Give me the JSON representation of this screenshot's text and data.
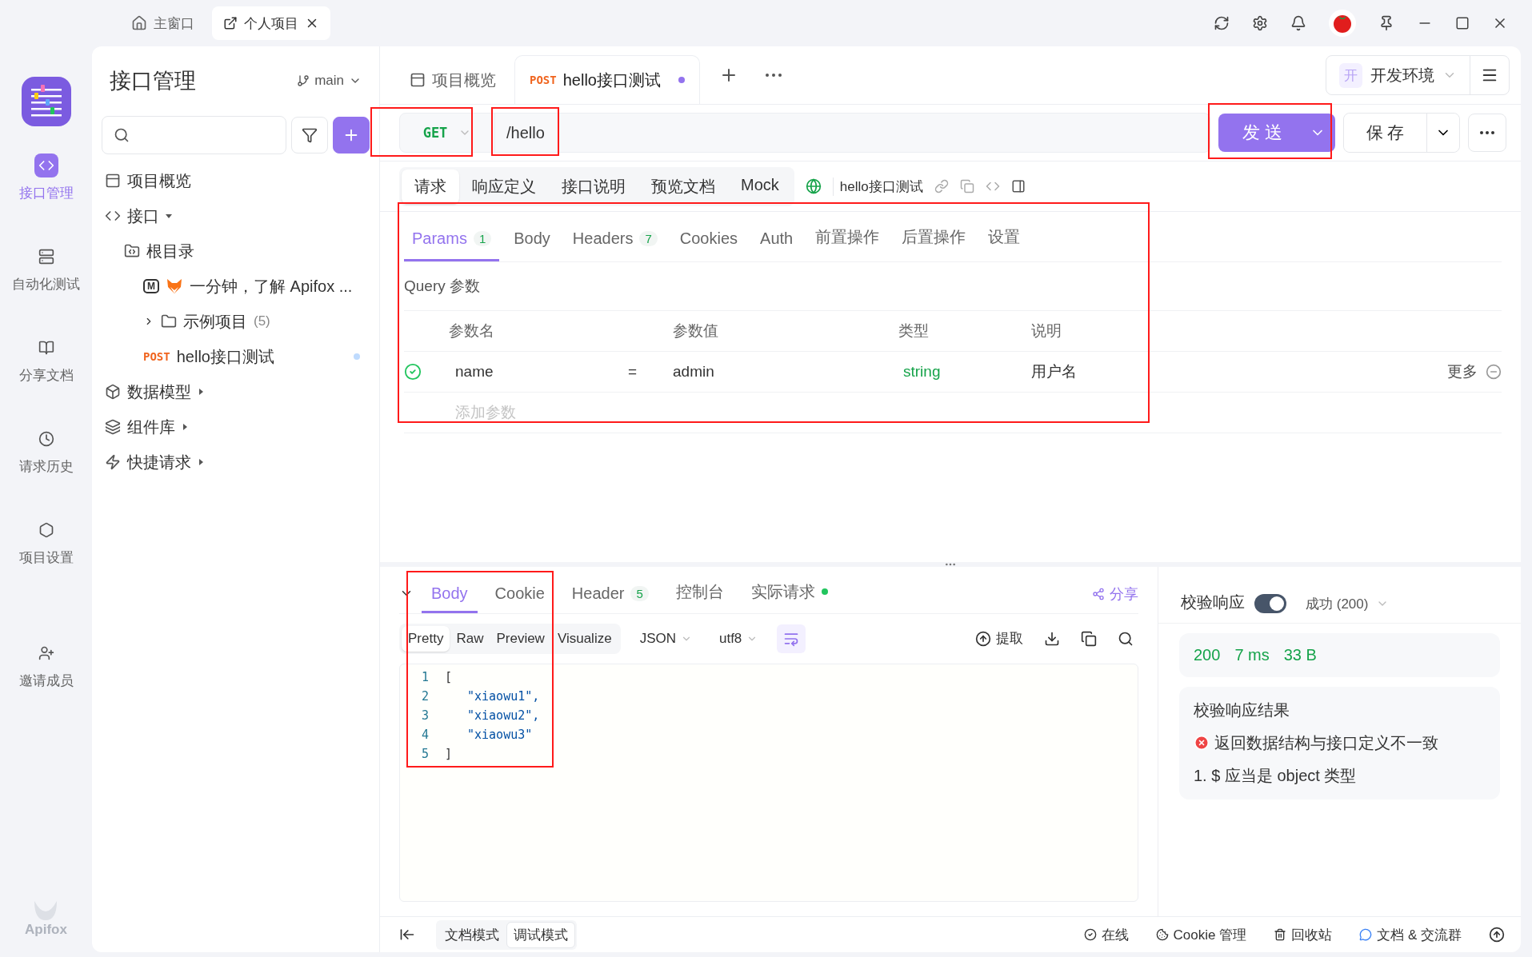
{
  "window_tabs": [
    {
      "label": "主窗口",
      "kind": "home",
      "selected": false
    },
    {
      "label": "个人项目",
      "kind": "project",
      "selected": true
    }
  ],
  "nav_rail": {
    "items": [
      {
        "label": "接口管理",
        "kind": "api",
        "selected": true
      },
      {
        "label": "自动化测试",
        "kind": "automation",
        "selected": false
      },
      {
        "label": "分享文档",
        "kind": "docs",
        "selected": false
      },
      {
        "label": "请求历史",
        "kind": "history",
        "selected": false
      },
      {
        "label": "项目设置",
        "kind": "settings",
        "selected": false
      },
      {
        "label": "邀请成员",
        "kind": "invite",
        "selected": false
      }
    ],
    "brand": "Apifox"
  },
  "sidebar": {
    "title": "接口管理",
    "branch": "main",
    "tree": [
      {
        "label": "项目概览",
        "kind": "overview"
      },
      {
        "label": "接口",
        "kind": "api",
        "expanded": true,
        "children": [
          {
            "label": "根目录",
            "kind": "root",
            "children": [
              {
                "label": "一分钟，了解 Apifox ...",
                "kind": "doc",
                "badge": "M"
              },
              {
                "label": "示例项目",
                "count": "(5)",
                "kind": "folder",
                "expanded": false
              },
              {
                "label": "hello接口测试",
                "method": "POST",
                "kind": "endpoint",
                "unsaved": true
              }
            ]
          }
        ]
      },
      {
        "label": "数据模型",
        "kind": "model",
        "expanded": false
      },
      {
        "label": "组件库",
        "kind": "components",
        "expanded": false
      },
      {
        "label": "快捷请求",
        "kind": "quick",
        "expanded": false
      }
    ]
  },
  "doc_tabs": [
    {
      "label": "项目概览",
      "kind": "overview",
      "selected": false
    },
    {
      "label": "hello接口测试",
      "method": "POST",
      "kind": "endpoint",
      "selected": true,
      "unsaved": true
    }
  ],
  "environment": {
    "badge": "开",
    "label": "开发环境"
  },
  "request": {
    "method": "GET",
    "url": "/hello",
    "send": "发 送",
    "save": "保 存",
    "method_highlighted": true,
    "url_highlighted": true,
    "send_highlighted": true
  },
  "sub_tabs": [
    {
      "label": "请求",
      "selected": true
    },
    {
      "label": "响应定义",
      "selected": false
    },
    {
      "label": "接口说明",
      "selected": false
    },
    {
      "label": "预览文档",
      "selected": false
    },
    {
      "label": "Mock",
      "selected": false
    }
  ],
  "api_name": "hello接口测试",
  "param_tabs": [
    {
      "label": "Params",
      "count": "1",
      "selected": true
    },
    {
      "label": "Body",
      "selected": false
    },
    {
      "label": "Headers",
      "count": "7",
      "selected": false
    },
    {
      "label": "Cookies",
      "selected": false
    },
    {
      "label": "Auth",
      "selected": false
    },
    {
      "label": "前置操作",
      "selected": false
    },
    {
      "label": "后置操作",
      "selected": false
    },
    {
      "label": "设置",
      "selected": false
    }
  ],
  "query": {
    "highlighted": true,
    "title": "Query 参数",
    "columns": [
      "参数名",
      "参数值",
      "类型",
      "说明"
    ],
    "rows": [
      {
        "enabled": true,
        "name": "name",
        "operator": "=",
        "value": "admin",
        "type": "string",
        "description": "用户名",
        "more": "更多"
      }
    ],
    "add_placeholder": "添加参数"
  },
  "response": {
    "body_highlighted": true,
    "tabs": [
      {
        "label": "Body",
        "selected": true
      },
      {
        "label": "Cookie",
        "selected": false
      },
      {
        "label": "Header",
        "count": "5",
        "selected": false
      },
      {
        "label": "控制台",
        "selected": false
      },
      {
        "label": "实际请求",
        "selected": false,
        "dot": true
      }
    ],
    "share": "分享",
    "views": [
      {
        "label": "Pretty",
        "selected": true
      },
      {
        "label": "Raw",
        "selected": false
      },
      {
        "label": "Preview",
        "selected": false
      },
      {
        "label": "Visualize",
        "selected": false
      }
    ],
    "format": "JSON",
    "encoding": "utf8",
    "extract": "提取",
    "code": [
      {
        "number": "1",
        "text": "[",
        "kind": "bracket"
      },
      {
        "number": "2",
        "text": "\"xiaowu1\",",
        "kind": "string"
      },
      {
        "number": "3",
        "text": "\"xiaowu2\",",
        "kind": "string"
      },
      {
        "number": "4",
        "text": "\"xiaowu3\"",
        "kind": "string"
      },
      {
        "number": "5",
        "text": "]",
        "kind": "bracket"
      }
    ]
  },
  "validation": {
    "label": "校验响应",
    "on": true,
    "status": "成功 (200)",
    "metrics": [
      "200",
      "7 ms",
      "33 B"
    ],
    "result_title": "校验响应结果",
    "error": "返回数据结构与接口定义不一致",
    "detail": "1. $ 应当是 object 类型"
  },
  "status_bar": {
    "modes": [
      {
        "label": "文档模式",
        "selected": false
      },
      {
        "label": "调试模式",
        "selected": true
      }
    ],
    "items": [
      {
        "label": "在线",
        "kind": "online"
      },
      {
        "label": "Cookie 管理",
        "kind": "cookie"
      },
      {
        "label": "回收站",
        "kind": "trash"
      },
      {
        "label": "文档 & 交流群",
        "kind": "chat"
      }
    ]
  }
}
